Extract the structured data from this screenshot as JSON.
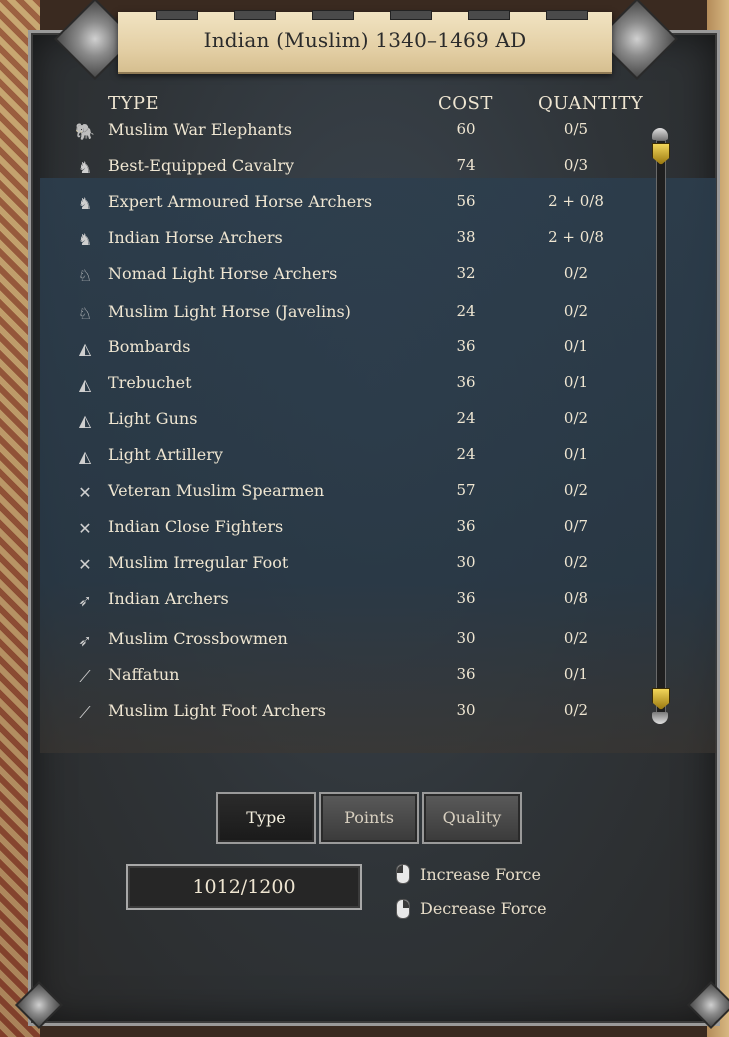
{
  "title": "Indian (Muslim) 1340–1469 AD",
  "columns": {
    "type": "TYPE",
    "cost": "COST",
    "quantity": "QUANTITY"
  },
  "units": [
    {
      "name": "Muslim War Elephants",
      "cost": "60",
      "quantity": "0/5",
      "icon": "elephant-icon",
      "glyph": "🐘"
    },
    {
      "name": "Best-Equipped Cavalry",
      "cost": "74",
      "quantity": "0/3",
      "icon": "heavy-cavalry-icon",
      "glyph": "♞"
    },
    {
      "name": "Expert Armoured Horse Archers",
      "cost": "56",
      "quantity": "2 + 0/8",
      "icon": "heavy-cavalry-icon",
      "glyph": "♞"
    },
    {
      "name": "Indian Horse Archers",
      "cost": "38",
      "quantity": "2 + 0/8",
      "icon": "heavy-cavalry-icon",
      "glyph": "♞"
    },
    {
      "name": "Nomad Light Horse Archers",
      "cost": "32",
      "quantity": "0/2",
      "icon": "light-cavalry-icon",
      "glyph": "♘"
    },
    {
      "name": "Muslim Light Horse (Javelins)",
      "cost": "24",
      "quantity": "0/2",
      "icon": "light-cavalry-icon",
      "glyph": "♘"
    },
    {
      "name": "Bombards",
      "cost": "36",
      "quantity": "0/1",
      "icon": "artillery-icon",
      "glyph": "◭"
    },
    {
      "name": "Trebuchet",
      "cost": "36",
      "quantity": "0/1",
      "icon": "artillery-icon",
      "glyph": "◭"
    },
    {
      "name": "Light Guns",
      "cost": "24",
      "quantity": "0/2",
      "icon": "artillery-icon",
      "glyph": "◭"
    },
    {
      "name": "Light Artillery",
      "cost": "24",
      "quantity": "0/1",
      "icon": "artillery-icon",
      "glyph": "◭"
    },
    {
      "name": "Veteran Muslim Spearmen",
      "cost": "57",
      "quantity": "0/2",
      "icon": "crossed-spears-icon",
      "glyph": "✕"
    },
    {
      "name": "Indian Close Fighters",
      "cost": "36",
      "quantity": "0/7",
      "icon": "crossed-spears-icon",
      "glyph": "✕"
    },
    {
      "name": "Muslim Irregular Foot",
      "cost": "30",
      "quantity": "0/2",
      "icon": "crossed-spears-icon",
      "glyph": "✕"
    },
    {
      "name": "Indian Archers",
      "cost": "36",
      "quantity": "0/8",
      "icon": "arrows-icon",
      "glyph": "➶"
    },
    {
      "name": "Muslim Crossbowmen",
      "cost": "30",
      "quantity": "0/2",
      "icon": "arrows-icon",
      "glyph": "➶"
    },
    {
      "name": "Naffatun",
      "cost": "36",
      "quantity": "0/1",
      "icon": "light-arrow-icon",
      "glyph": "⟋"
    },
    {
      "name": "Muslim Light Foot Archers",
      "cost": "30",
      "quantity": "0/2",
      "icon": "light-arrow-icon",
      "glyph": "⟋"
    }
  ],
  "sort_buttons": {
    "type": "Type",
    "points": "Points",
    "quality": "Quality"
  },
  "force": {
    "points": "1012/1200"
  },
  "hints": {
    "increase": "Increase Force",
    "decrease": "Decrease Force"
  },
  "colors": {
    "text": "#efe6d2",
    "thumb": "#d4b030",
    "banner": "#e8d7b0"
  }
}
